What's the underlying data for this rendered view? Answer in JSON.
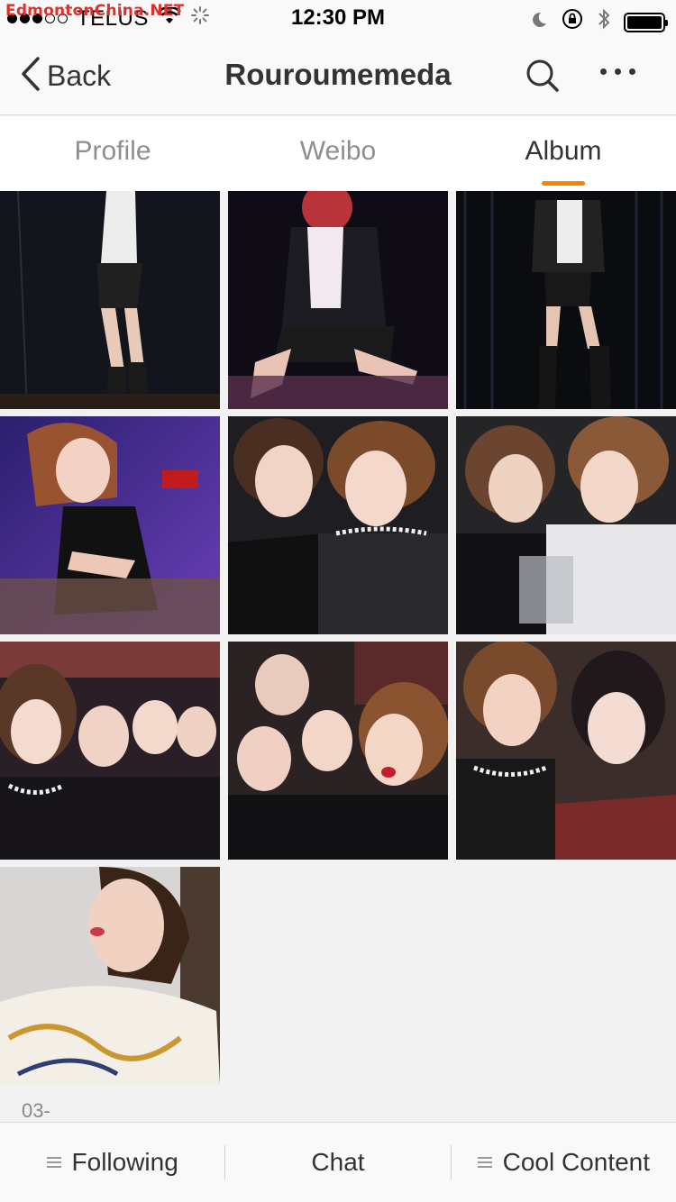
{
  "status_bar": {
    "watermark": "EdmontonChina.NET",
    "carrier": "TELUS",
    "time": "12:30 PM"
  },
  "nav": {
    "back_label": "Back",
    "title": "Rouroumemeda"
  },
  "tabs": [
    {
      "label": "Profile",
      "active": false
    },
    {
      "label": "Weibo",
      "active": false
    },
    {
      "label": "Album",
      "active": true
    }
  ],
  "album": {
    "date_label": "03-"
  },
  "bottom_bar": {
    "following_label": "Following",
    "chat_label": "Chat",
    "cool_content_label": "Cool Content"
  },
  "colors": {
    "accent": "#ff8200",
    "tab_inactive": "#8e8e8e"
  }
}
